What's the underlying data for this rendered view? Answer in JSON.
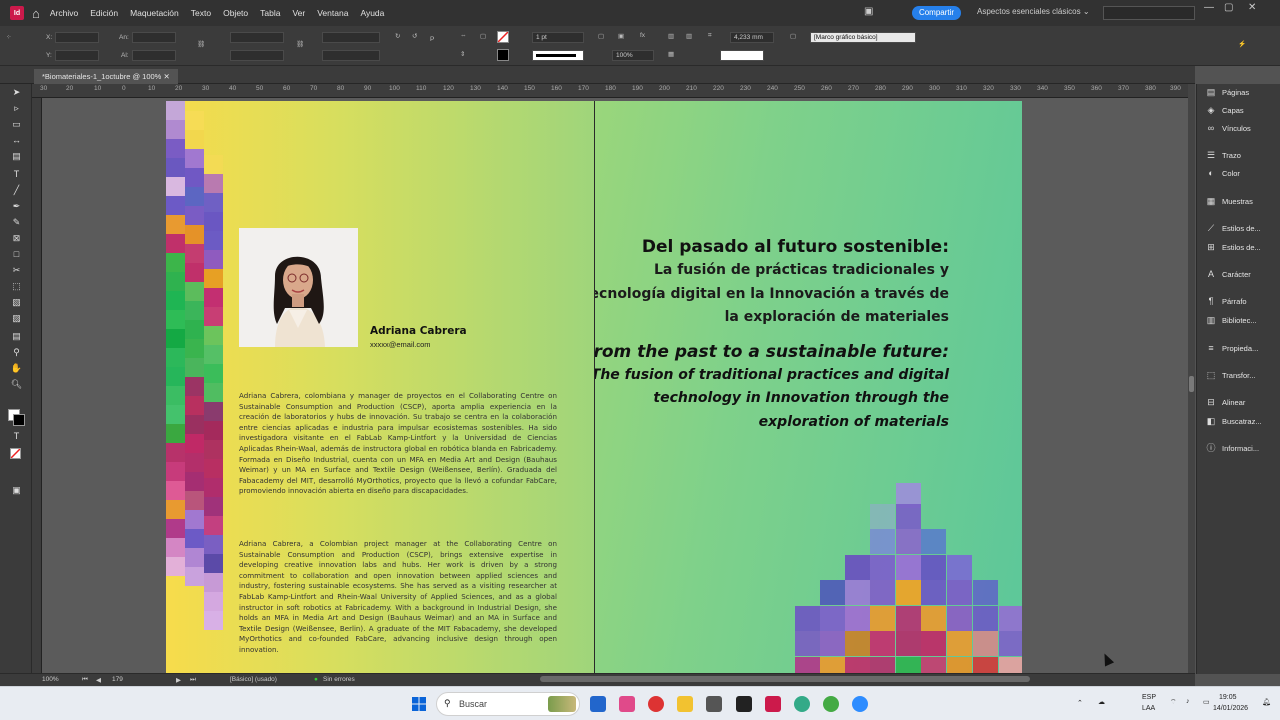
{
  "app": {
    "logo_label": "Id"
  },
  "menu": [
    "Archivo",
    "Edición",
    "Maquetación",
    "Texto",
    "Objeto",
    "Tabla",
    "Ver",
    "Ventana",
    "Ayuda"
  ],
  "share_label": "Compartir",
  "workspace_label": "Aspectos esenciales clásicos",
  "control": {
    "x_label": "X:",
    "y_label": "Y:",
    "w_label": "An:",
    "h_label": "Al:",
    "stroke_weight": "1 pt",
    "zoom_pct": "100%",
    "offset": "4,233 mm",
    "frame_style": "[Marco gráfico básico]"
  },
  "doc_tab": "*Biomateriales-1_1octubre @ 100%",
  "ruler_labels": [
    "30",
    "20",
    "10",
    "0",
    "10",
    "20",
    "30",
    "40",
    "50",
    "60",
    "70",
    "80",
    "90",
    "100",
    "110",
    "120",
    "130",
    "140",
    "150",
    "160",
    "170",
    "180",
    "190",
    "200",
    "210",
    "220",
    "230",
    "240",
    "250",
    "260",
    "270",
    "280",
    "290",
    "300",
    "310",
    "320",
    "330",
    "340",
    "350",
    "360",
    "370",
    "380",
    "390",
    "400"
  ],
  "left_page": {
    "name": "Adriana Cabrera",
    "email": "xxxxx@email.com",
    "bio_es": "Adriana Cabrera, colombiana y manager de proyectos en el Collaborating Centre on Sustainable Consumption and Production (CSCP), aporta amplia experiencia en la creación de laboratorios y hubs de innovación. Su trabajo se centra en la colaboración entre ciencias aplicadas e industria para impulsar ecosistemas sostenibles. Ha sido investigadora visitante en el FabLab Kamp-Lintfort y la Universidad de Ciencias Aplicadas Rhein-Waal, además de instructora global en robótica blanda en Fabricademy. Formada en Diseño Industrial, cuenta con un MFA en Media Art and Design (Bauhaus Weimar) y un MA en Surface and Textile Design (Weißensee, Berlín). Graduada del Fabacademy del MIT, desarrolló MyOrthotics, proyecto que la llevó a cofundar FabCare, promoviendo innovación abierta en diseño para discapacidades.",
    "bio_en": "Adriana Cabrera, a Colombian project manager at the Collaborating Centre on Sustainable Consumption and Production (CSCP), brings extensive expertise in developing creative innovation labs and hubs. Her work is driven by a strong commitment to collaboration and open innovation between applied sciences and industry, fostering sustainable ecosystems. She has served as a visiting researcher at FabLab Kamp-Lintfort and Rhein-Waal University of Applied Sciences, and as a global instructor in soft robotics at Fabricademy. With a background in Industrial Design, she holds an MFA in Media Art and Design (Bauhaus Weimar) and an MA in Surface and Textile Design (Weißensee, Berlin). A graduate of the MIT Fabacademy, she developed MyOrthotics and co-founded FabCare, advancing inclusive design through open innovation."
  },
  "right_page": {
    "title_es": "Del pasado al futuro sostenible:",
    "subtitle_es": "La fusión de prácticas tradicionales y tecnología digital en la Innovación a través de la exploración de materiales",
    "title_en": "From the past to a sustainable future:",
    "subtitle_en": "The fusion of traditional practices and digital technology in Innovation through the exploration of materials"
  },
  "panels": [
    "Páginas",
    "Capas",
    "Vínculos",
    "Trazo",
    "Color",
    "Muestras",
    "Estilos de...",
    "Estilos de...",
    "Carácter",
    "Párrafo",
    "Bibliotec...",
    "Propieda...",
    "Transfor...",
    "Alinear",
    "Buscatraz...",
    "Informaci..."
  ],
  "status": {
    "zoom": "100%",
    "page": "179",
    "style": "[Básico] (usado)",
    "errors": "Sin errores"
  },
  "taskbar": {
    "search": "Buscar",
    "lang": "ESP",
    "layout": "LAA",
    "time": "19:05",
    "date": "14/01/2026"
  },
  "colors": {
    "accent": "#2680eb",
    "indesign": "#cc1a4b"
  }
}
